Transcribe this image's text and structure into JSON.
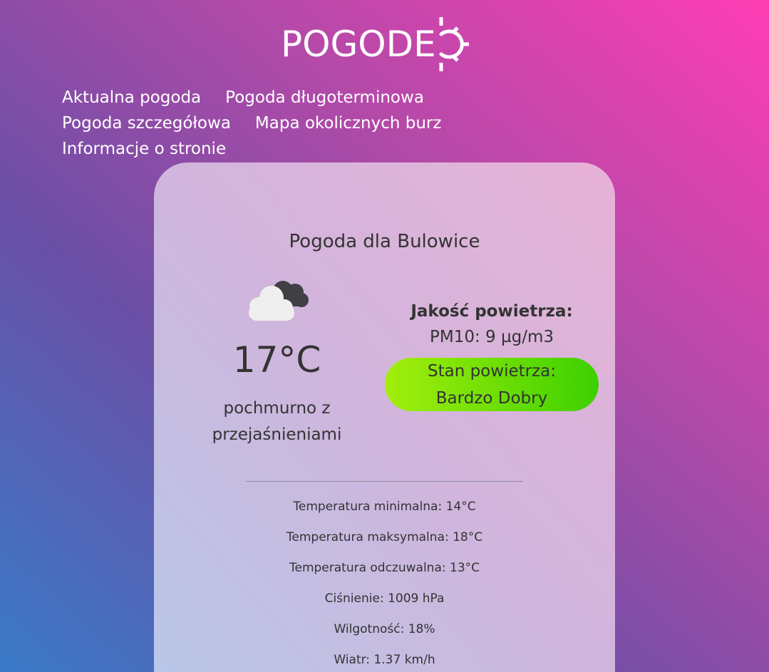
{
  "logo": {
    "text": "POGODE"
  },
  "nav": {
    "items": [
      {
        "label": "Aktualna pogoda"
      },
      {
        "label": "Pogoda długoterminowa"
      },
      {
        "label": "Pogoda szczegółowa"
      },
      {
        "label": "Mapa okolicznych burz"
      },
      {
        "label": "Informacje o stronie"
      }
    ]
  },
  "weather": {
    "title": "Pogoda dla Bulowice",
    "icon": "cloudy-icon",
    "temperature": "17°C",
    "description_line1": "pochmurno z",
    "description_line2": "przejaśnieniami"
  },
  "air": {
    "title": "Jakość powietrza:",
    "pm10": "PM10: 9 µg/m3",
    "state_label": "Stan powietrza:",
    "state_value": "Bardzo Dobry"
  },
  "details": {
    "temp_min": "Temperatura minimalna: 14°C",
    "temp_max": "Temperatura maksymalna: 18°C",
    "temp_feels": "Temperatura odczuwalna: 13°C",
    "pressure": "Ciśnienie: 1009 hPa",
    "humidity": "Wilgotność: 18%",
    "wind": "Wiatr: 1.37 km/h"
  },
  "colors": {
    "air_good_start": "#a3ee0b",
    "air_good_end": "#3dd000"
  }
}
